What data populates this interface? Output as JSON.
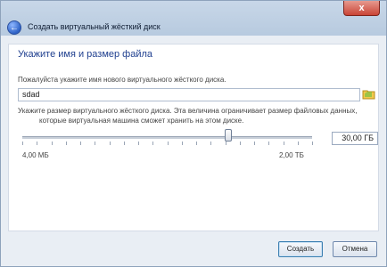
{
  "window": {
    "title": "Создать виртуальный жёсткий диск",
    "close_label": "x"
  },
  "page": {
    "heading": "Укажите имя и размер файла",
    "name_hint": "Пожалуйста укажите имя нового виртуального жёсткого диска.",
    "name_value": "sdad",
    "size_hint_line1": "Укажите размер виртуального жёсткого диска. Эта величина ограничивает размер файловых данных,",
    "size_hint_line2": "которые виртуальная машина сможет хранить на этом диске.",
    "size_value": "30,00 ГБ",
    "size_min": "4,00 МБ",
    "size_max": "2,00 ТБ",
    "slider_position": 0.71
  },
  "footer": {
    "create_label": "Создать",
    "cancel_label": "Отмена"
  }
}
